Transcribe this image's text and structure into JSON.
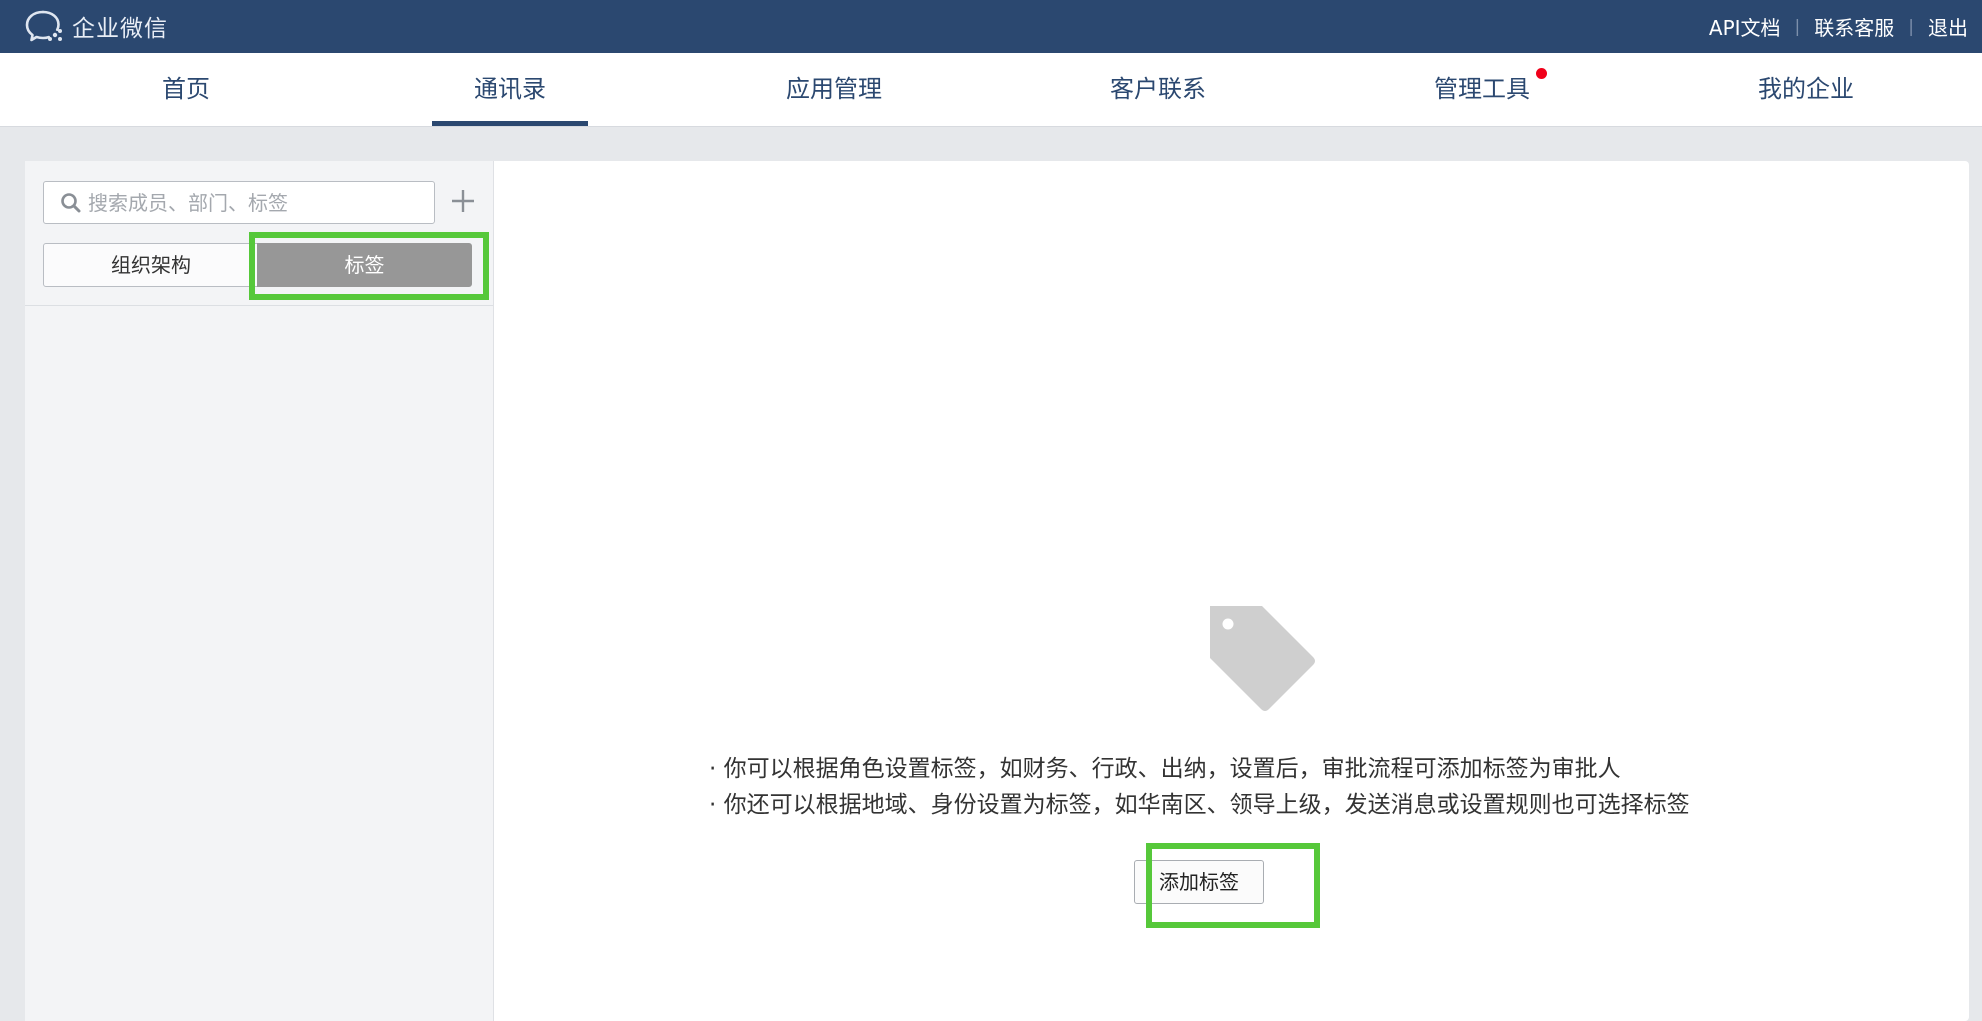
{
  "topbar": {
    "logo_text": "企业微信",
    "links": [
      "API文档",
      "联系客服",
      "退出"
    ],
    "separator": "|"
  },
  "nav": {
    "items": [
      {
        "label": "首页",
        "active": false
      },
      {
        "label": "通讯录",
        "active": true
      },
      {
        "label": "应用管理",
        "active": false
      },
      {
        "label": "客户联系",
        "active": false
      },
      {
        "label": "管理工具",
        "active": false,
        "badge": "red-dot"
      },
      {
        "label": "我的企业",
        "active": false
      }
    ]
  },
  "sidebar": {
    "search_placeholder": "搜索成员、部门、标签",
    "segments": [
      {
        "label": "组织架构",
        "selected": false
      },
      {
        "label": "标签",
        "selected": true
      }
    ]
  },
  "empty_state": {
    "icon": "tag-icon",
    "tips": [
      "· 你可以根据角色设置标签，如财务、行政、出纳，设置后，审批流程可添加标签为审批人",
      "· 你还可以根据地域、身份设置为标签，如华南区、领导上级，发送消息或设置规则也可选择标签"
    ],
    "add_button_label": "添加标签"
  },
  "colors": {
    "topbar_bg": "#2b4870",
    "nav_active": "#2b4870",
    "highlight": "#56c83a",
    "selected_segment": "#979797",
    "badge": "#f0001a"
  }
}
